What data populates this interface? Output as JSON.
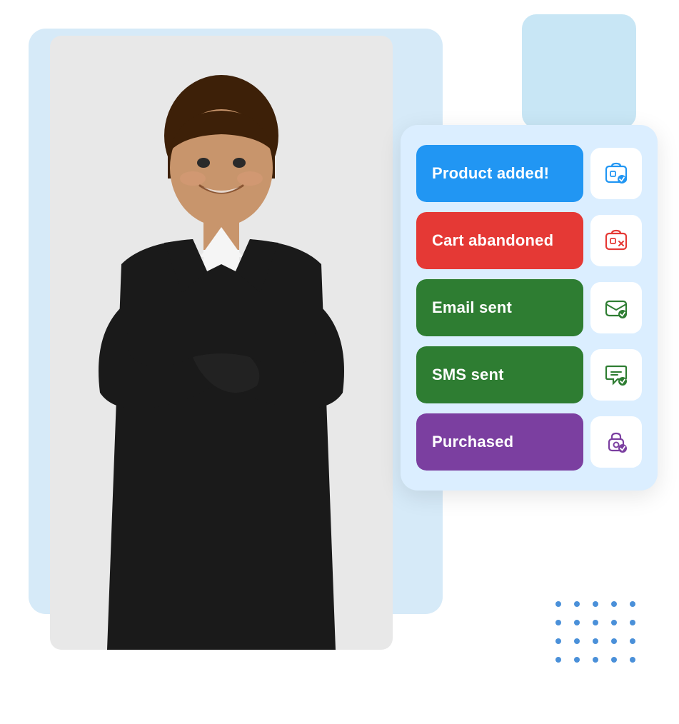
{
  "background": {
    "main_rect_color": "#d6eaf8",
    "accent_rect_color": "#c8e6f5",
    "card_bg": "#dbeeff"
  },
  "card": {
    "rows": [
      {
        "id": "product-added",
        "label": "Product added!",
        "color_class": "row-blue",
        "bg_color": "#2196F3",
        "icon": "store",
        "icon_color": "#2196F3"
      },
      {
        "id": "cart-abandoned",
        "label": "Cart abandoned",
        "color_class": "row-red",
        "bg_color": "#E53935",
        "icon": "store-cart",
        "icon_color": "#E53935"
      },
      {
        "id": "email-sent",
        "label": "Email sent",
        "color_class": "row-green-email",
        "bg_color": "#2E7D32",
        "icon": "email-check",
        "icon_color": "#2E7D32"
      },
      {
        "id": "sms-sent",
        "label": "SMS sent",
        "color_class": "row-green-sms",
        "bg_color": "#2E7D32",
        "icon": "sms",
        "icon_color": "#2E7D32"
      },
      {
        "id": "purchased",
        "label": "Purchased",
        "color_class": "row-purple",
        "bg_color": "#7B3FA0",
        "icon": "lock-check",
        "icon_color": "#7B3FA0"
      }
    ]
  },
  "dots": {
    "color": "#4A90D9",
    "count": 20
  }
}
